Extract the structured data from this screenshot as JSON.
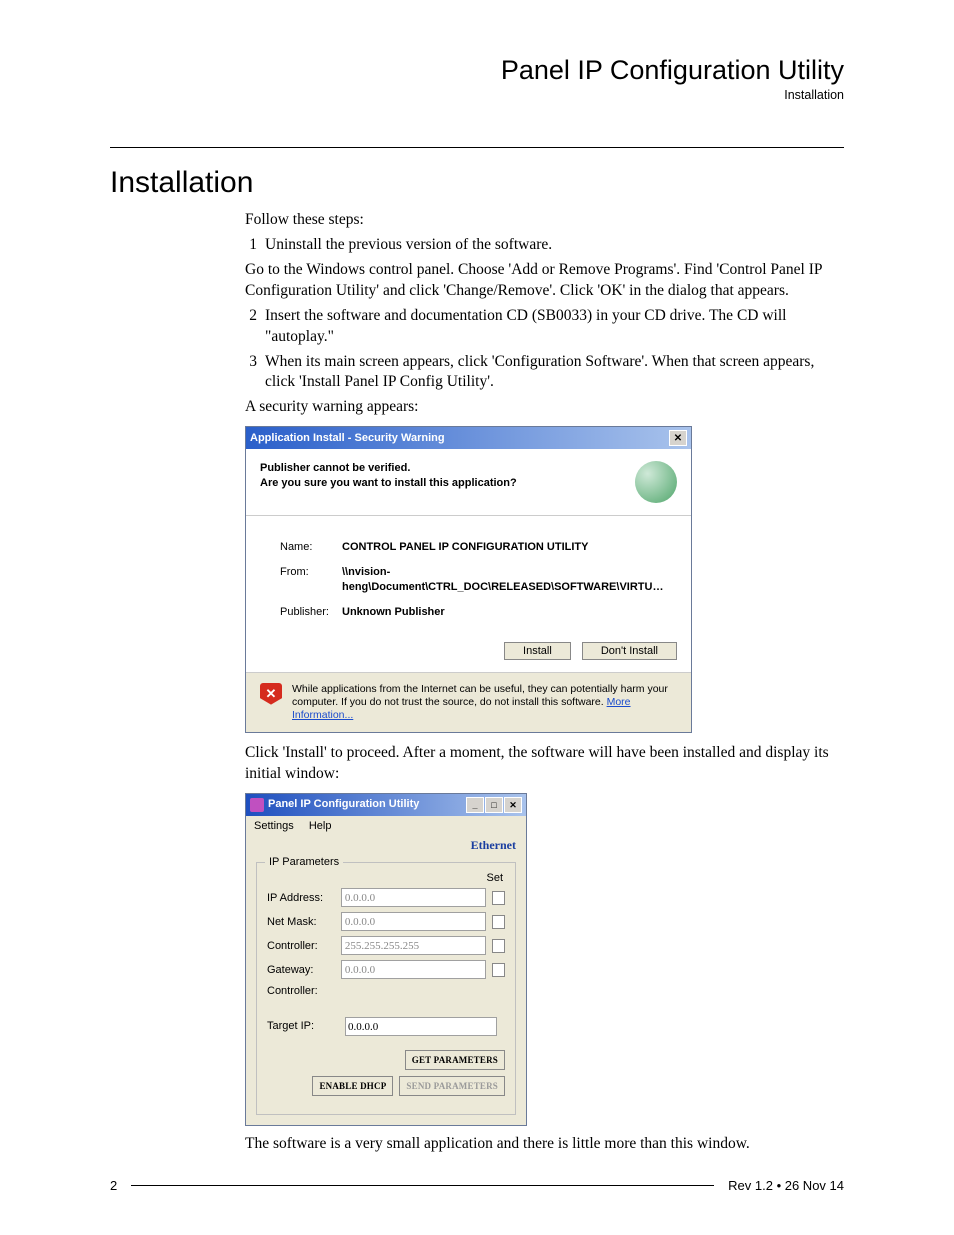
{
  "header": {
    "title": "Panel IP Configuration Utility",
    "subtitle": "Installation"
  },
  "section_heading": "Installation",
  "intro": "Follow these steps:",
  "steps": [
    {
      "n": "1",
      "text": "Uninstall the previous version of the software.",
      "more": "Go to the Windows control panel. Choose 'Add or Remove Programs'. Find 'Control Panel IP Configuration Utility' and click 'Change/Remove'. Click 'OK' in the dialog that appears."
    },
    {
      "n": "2",
      "text": "Insert the software and documentation CD (SB0033) in your CD drive. The CD will \"autoplay.\""
    },
    {
      "n": "3",
      "text": "When its main screen appears, click 'Configuration Software'. When that screen appears, click 'Install Panel IP Config Utility'.",
      "after": "A security warning appears:"
    }
  ],
  "dialog": {
    "title": "Application Install - Security Warning",
    "line1": "Publisher cannot be verified.",
    "line2": "Are you sure you want to install this application?",
    "fields": {
      "name_label": "Name:",
      "name_value": "CONTROL PANEL IP CONFIGURATION UTILITY",
      "from_label": "From:",
      "from_value": "\\\\nvision-heng\\Document\\CTRL_DOC\\RELEASED\\SOFTWARE\\VIRTU…",
      "publisher_label": "Publisher:",
      "publisher_value": "Unknown Publisher"
    },
    "install_btn": "Install",
    "dont_install_btn": "Don't Install",
    "warning": "While applications from the Internet can be useful, they can potentially harm your computer. If you do not trust the source, do not install this software. ",
    "more_info": "More Information..."
  },
  "after_dialog": "Click 'Install' to proceed. After a moment, the software will have been installed and display its initial window:",
  "ipwin": {
    "title": "Panel IP Configuration Utility",
    "menu": {
      "settings": "Settings",
      "help": "Help"
    },
    "ethernet": "Ethernet",
    "group_legend": "IP Parameters",
    "set_label": "Set",
    "rows": {
      "ip_label": "IP Address:",
      "ip_val": "0.0.0.0",
      "mask_label": "Net Mask:",
      "mask_val": "0.0.0.0",
      "ctrl1_label": "Controller:",
      "ctrl1_val": "255.255.255.255",
      "gw_label": "Gateway:",
      "gw_val": "0.0.0.0",
      "ctrl2_label": "Controller:",
      "target_label": "Target IP:",
      "target_val": "0.0.0.0"
    },
    "buttons": {
      "get": "GET PARAMETERS",
      "dhcp": "ENABLE DHCP",
      "send": "SEND PARAMETERS"
    }
  },
  "closing": "The software is a very small application and there is little more than this window.",
  "footer": {
    "page": "2",
    "rev": "Rev 1.2 • 26 Nov 14"
  }
}
